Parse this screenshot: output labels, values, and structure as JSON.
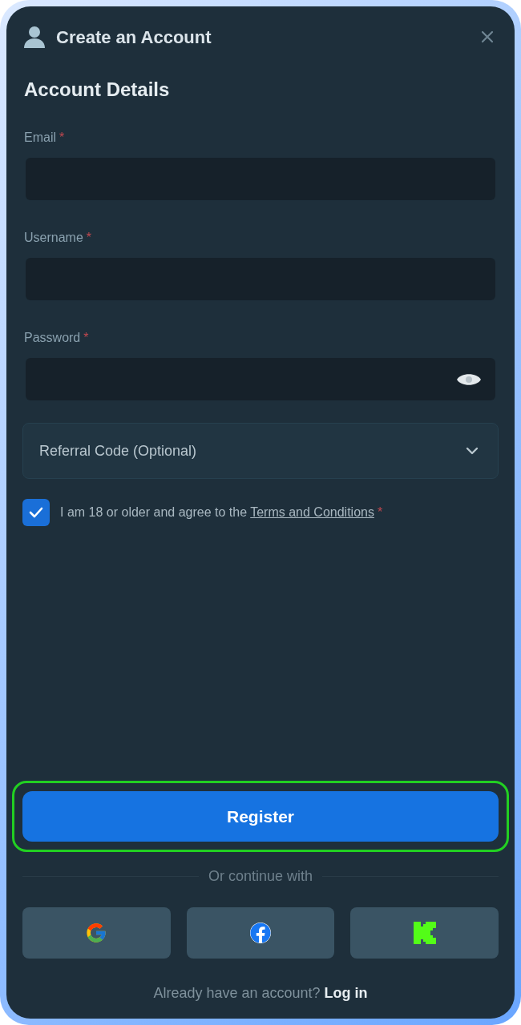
{
  "dialog": {
    "title": "Create an Account"
  },
  "section_title": "Account Details",
  "fields": [
    {
      "kind": "text",
      "label": "Email",
      "marker": "*"
    },
    {
      "kind": "text",
      "label": "Username",
      "marker": "*"
    },
    {
      "kind": "password",
      "label": "Password",
      "marker": "*"
    }
  ],
  "referral": {
    "label": "Referral Code (Optional)",
    "expanded": false
  },
  "agreement": {
    "checked": true,
    "text": "I am 18 or older and agree to the",
    "link": "Terms and Conditions",
    "marker": "*"
  },
  "register_button": {
    "label": "Register",
    "highlighted": true
  },
  "divider_text": "Or continue with",
  "social_buttons": [
    {
      "kind": "google"
    },
    {
      "kind": "facebook"
    },
    {
      "kind": "kick"
    }
  ],
  "footer": {
    "text": "Already have an account?",
    "link": "Log in"
  }
}
